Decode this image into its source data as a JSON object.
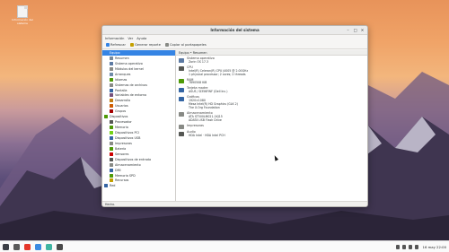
{
  "desktop": {
    "icon_label": "Información del sistema",
    "icon_name": "document-icon"
  },
  "window": {
    "title": "Información del sistema",
    "controls": {
      "minimize": "–",
      "maximize": "□",
      "close": "✕"
    }
  },
  "menubar": {
    "items": [
      "Información",
      "Ver",
      "Ayuda"
    ]
  },
  "toolbar": {
    "refresh": "Refrescar",
    "report": "Generar reporte",
    "copy": "Copiar al portapapeles"
  },
  "sidebar": {
    "items": [
      {
        "label": "Equipo",
        "level": 0,
        "color": "#3584e4",
        "selected": true
      },
      {
        "label": "Resumen",
        "level": 1,
        "color": "#7a8a9a"
      },
      {
        "label": "Sistema operativo",
        "level": 1,
        "color": "#5c7aa3"
      },
      {
        "label": "Módulos del kernel",
        "level": 1,
        "color": "#888a85"
      },
      {
        "label": "Arranques",
        "level": 1,
        "color": "#6d8aa8"
      },
      {
        "label": "Idiomas",
        "level": 1,
        "color": "#4e9a06"
      },
      {
        "label": "Sistemas de archivos",
        "level": 1,
        "color": "#888a85"
      },
      {
        "label": "Pantalla",
        "level": 1,
        "color": "#3465a4"
      },
      {
        "label": "Variables de entorno",
        "level": 1,
        "color": "#75507b"
      },
      {
        "label": "Desarrollo",
        "level": 1,
        "color": "#c17d11"
      },
      {
        "label": "Usuarios",
        "level": 1,
        "color": "#ce5c00"
      },
      {
        "label": "Grupos",
        "level": 1,
        "color": "#a40000"
      },
      {
        "label": "Dispositivos",
        "level": 0,
        "color": "#4e9a06"
      },
      {
        "label": "Procesador",
        "level": 1,
        "color": "#555753"
      },
      {
        "label": "Memoria",
        "level": 1,
        "color": "#4e9a06"
      },
      {
        "label": "Dispositivos PCI",
        "level": 1,
        "color": "#73d216"
      },
      {
        "label": "Dispositivos USB",
        "level": 1,
        "color": "#3465a4"
      },
      {
        "label": "Impresoras",
        "level": 1,
        "color": "#888a85"
      },
      {
        "label": "Batería",
        "level": 1,
        "color": "#4e9a06"
      },
      {
        "label": "Sensores",
        "level": 1,
        "color": "#cc0000"
      },
      {
        "label": "Dispositivos de entrada",
        "level": 1,
        "color": "#555753"
      },
      {
        "label": "Almacenamiento",
        "level": 1,
        "color": "#888a85"
      },
      {
        "label": "DMI",
        "level": 1,
        "color": "#3465a4"
      },
      {
        "label": "Memoria SPD",
        "level": 1,
        "color": "#4e9a06"
      },
      {
        "label": "Recursos",
        "level": 1,
        "color": "#c4a000"
      },
      {
        "label": "Red",
        "level": 0,
        "color": "#3465a4"
      }
    ]
  },
  "main": {
    "header": "Equipo • Resumen",
    "sections": [
      {
        "title": "Sistema operativo",
        "lines": [
          "Zorin OS 17.3"
        ],
        "color": "#5c7aa3"
      },
      {
        "title": "CPU",
        "lines": [
          "Intel(R) Celeron(R) CPU J4005 @ 2.00GHz",
          "1 physical processor; 2 cores; 2 threads"
        ],
        "color": "#555753"
      },
      {
        "title": "RAM",
        "lines": [
          "7890508 KiB"
        ],
        "color": "#4e9a06"
      },
      {
        "title": "Tarjeta madre",
        "lines": [
          "ASUS / D356FWF (Dell Inc.)"
        ],
        "color": "#3465a4"
      },
      {
        "title": "Gráficos",
        "lines": [
          "1920×1080",
          "Mesa Intel(R) HD Graphics (GLK 2)",
          "The X.Org Foundation"
        ],
        "color": "#3465a4"
      },
      {
        "title": "Almacenamiento",
        "lines": [
          "ATA ST500LM021-1KJ15",
          "ADATA USB Flash Drive"
        ],
        "color": "#888a85"
      },
      {
        "title": "Impresoras",
        "lines": [],
        "color": "#888a85"
      },
      {
        "title": "Audio",
        "lines": [
          "HDA Intel · HDA Intel PCH"
        ],
        "color": "#555753"
      }
    ]
  },
  "statusbar": {
    "text": "Hecho."
  },
  "taskbar": {
    "apps": [
      {
        "name": "zorin-menu-icon",
        "color": "#3c3f46"
      },
      {
        "name": "windows-icon",
        "color": "#5a5a5a"
      },
      {
        "name": "browser-icon",
        "color": "#e5372a"
      },
      {
        "name": "files-icon",
        "color": "#3c8be2"
      },
      {
        "name": "software-icon",
        "color": "#3fb5a2"
      },
      {
        "name": "system-info-icon",
        "color": "#4a4a4a"
      }
    ],
    "clock": "16 may 22:00"
  }
}
